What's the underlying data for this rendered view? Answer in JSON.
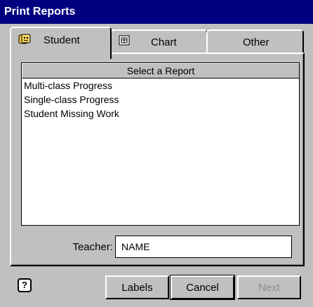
{
  "window": {
    "title": "Print Reports"
  },
  "tabs": [
    {
      "label": "Student",
      "icon": "student-icon",
      "active": true
    },
    {
      "label": "Chart",
      "icon": "chart-icon",
      "active": false
    },
    {
      "label": "Other",
      "active": false
    }
  ],
  "list": {
    "header": "Select a Report",
    "items": [
      "Multi-class Progress",
      "Single-class Progress",
      "Student Missing Work"
    ]
  },
  "teacher": {
    "label": "Teacher:",
    "value": "NAME"
  },
  "help": {
    "glyph": "?"
  },
  "buttons": {
    "labels": "Labels",
    "cancel": "Cancel",
    "next": "Next"
  },
  "colors": {
    "titlebar": "#000080",
    "face": "#c0c0c0",
    "disabled_text": "#8c8c8c"
  }
}
